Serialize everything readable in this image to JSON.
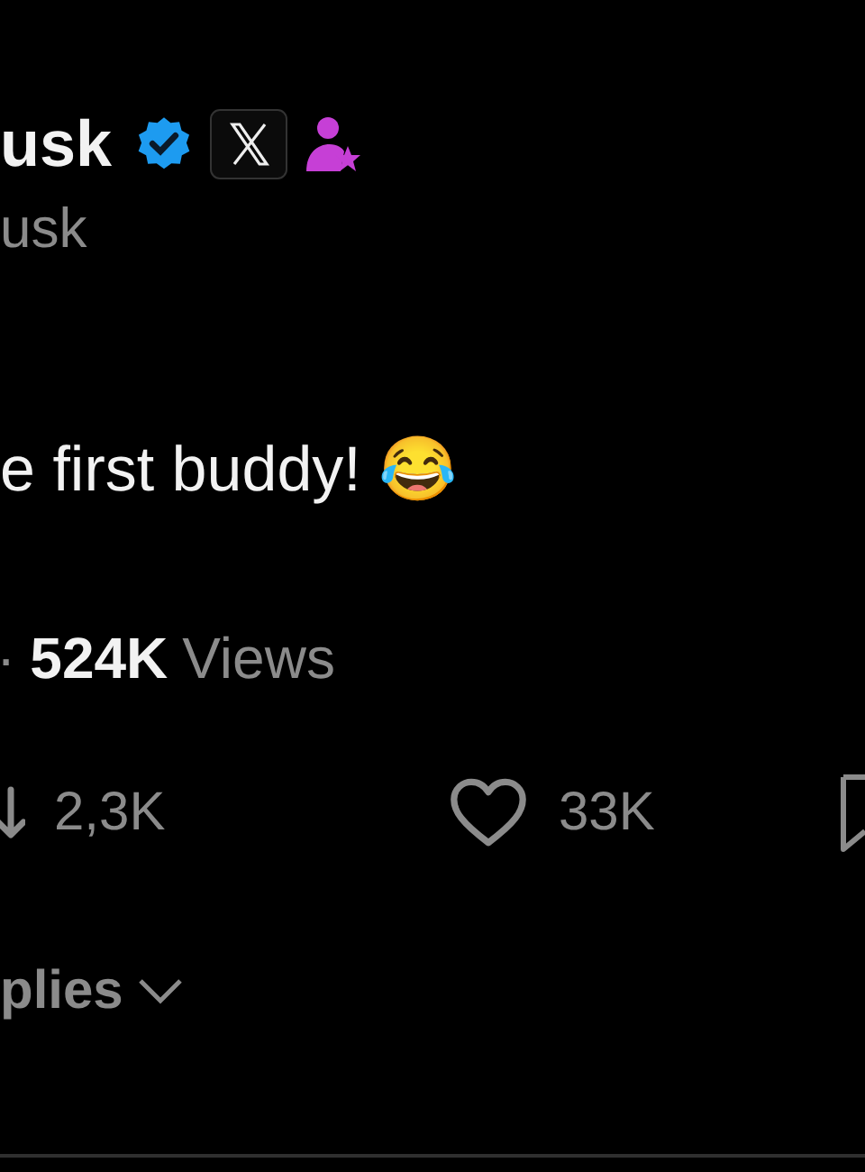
{
  "author": {
    "name": "usk",
    "handle": "usk"
  },
  "tweet": {
    "text": "e first buddy! 😂"
  },
  "meta": {
    "separator": "·",
    "views_count": "524K",
    "views_label": "Views"
  },
  "actions": [
    {
      "kind": "repost",
      "count": "2,3K"
    },
    {
      "kind": "like",
      "count": "33K"
    },
    {
      "kind": "bookmark"
    }
  ],
  "replies": {
    "label": "plies"
  }
}
